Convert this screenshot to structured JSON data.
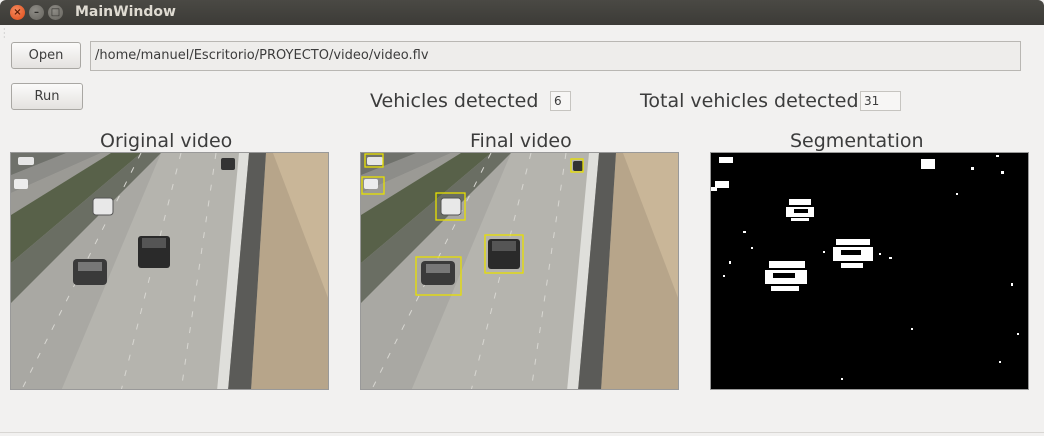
{
  "window": {
    "title": "MainWindow",
    "controls": {
      "close": "×",
      "minimize": "–",
      "maximize": "□"
    }
  },
  "toolbar": {
    "open_label": "Open",
    "run_label": "Run",
    "path_value": "/home/manuel/Escritorio/PROYECTO/video/video.flv"
  },
  "stats": {
    "vehicles_label": "Vehicles detected",
    "vehicles_value": "6",
    "total_label": "Total vehicles detected",
    "total_value": "31"
  },
  "panels": {
    "original_title": "Original video",
    "final_title": "Final video",
    "segmentation_title": "Segmentation"
  },
  "colors": {
    "detection_box": "#e8e000",
    "close_button": "#df4a16",
    "titlebar": "#3c3b37"
  }
}
